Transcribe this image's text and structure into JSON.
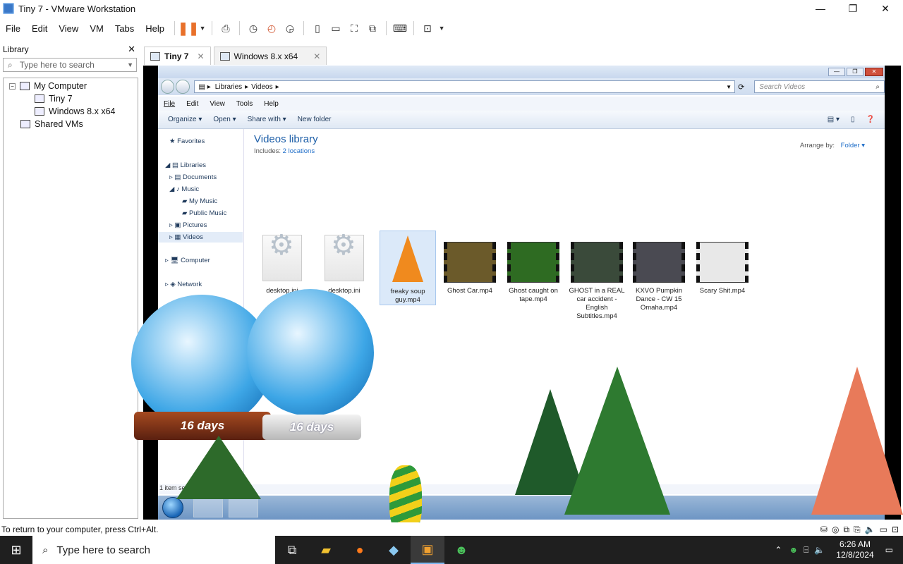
{
  "window": {
    "title": "Tiny 7 - VMware Workstation"
  },
  "menubar": {
    "items": [
      "File",
      "Edit",
      "View",
      "VM",
      "Tabs",
      "Help"
    ]
  },
  "library": {
    "title": "Library",
    "search_placeholder": "Type here to search",
    "tree": [
      {
        "label": "My Computer"
      },
      {
        "label": "Tiny 7"
      },
      {
        "label": "Windows 8.x x64"
      },
      {
        "label": "Shared VMs"
      }
    ]
  },
  "tabs": [
    {
      "label": "Tiny 7",
      "active": true
    },
    {
      "label": "Windows 8.x x64",
      "active": false
    }
  ],
  "explorer": {
    "breadcrumb": [
      "Libraries",
      "Videos"
    ],
    "search_placeholder": "Search Videos",
    "menu": [
      "File",
      "Edit",
      "View",
      "Tools",
      "Help"
    ],
    "commands": [
      "Organize ▾",
      "Open ▾",
      "Share with ▾",
      "New folder"
    ],
    "nav": {
      "favorites": "Favorites",
      "libraries": "Libraries",
      "documents": "Documents",
      "music": "Music",
      "my_music": "My Music",
      "public_music": "Public Music",
      "pictures": "Pictures",
      "videos": "Videos",
      "computer": "Computer",
      "network": "Network"
    },
    "library_title": "Videos library",
    "includes_label": "Includes:",
    "includes_link": "2 locations",
    "arrange_label": "Arrange by:",
    "arrange_value": "Folder ▾",
    "files": [
      {
        "name": "desktop.ini",
        "kind": "ini"
      },
      {
        "name": "desktop.ini",
        "kind": "ini"
      },
      {
        "name": "freaky soup guy.mp4",
        "kind": "vlc"
      },
      {
        "name": "Ghost Car.mp4",
        "kind": "video",
        "color": "#6b5a2a"
      },
      {
        "name": "Ghost caught on tape.mp4",
        "kind": "video",
        "color": "#2e6b22"
      },
      {
        "name": "GHOST in a REAL car accident - English Subtitles.mp4",
        "kind": "video",
        "color": "#3a4a3a"
      },
      {
        "name": "KXVO Pumpkin Dance - CW 15 Omaha.mp4",
        "kind": "video",
        "color": "#4a4a52"
      },
      {
        "name": "Scary Shit.mp4",
        "kind": "video",
        "color": "#e8e8e8"
      }
    ],
    "status": "1 item selected"
  },
  "decor": {
    "globe_left_text": "16 days",
    "globe_right_text": "16 days"
  },
  "vmware_status": "To return to your computer, press Ctrl+Alt.",
  "taskbar": {
    "search_placeholder": "Type here to search",
    "time": "6:26 AM",
    "date": "12/8/2024"
  }
}
